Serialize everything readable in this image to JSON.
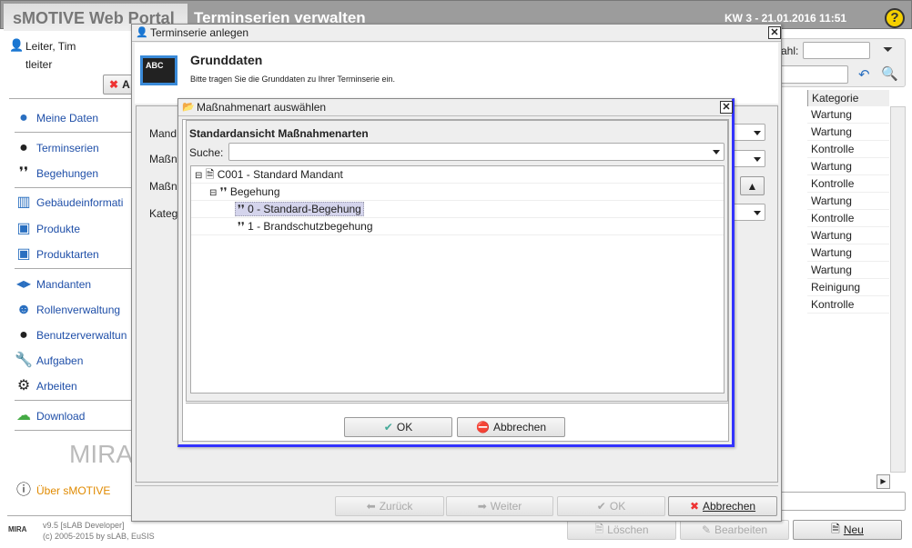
{
  "header": {
    "app_title": "sMOTIVE Web Portal",
    "page_title": "Terminserien verwalten",
    "datetime": "KW 3 - 21.01.2016 11:51",
    "help_icon": "help-icon"
  },
  "user": {
    "name": "Leiter, Tim",
    "login": "tleiter",
    "logout_label": "A"
  },
  "sidebar": {
    "items": [
      {
        "label": "Meine Daten",
        "icon": "user-icon"
      },
      {
        "label": "Terminserien",
        "icon": "series-icon"
      },
      {
        "label": "Begehungen",
        "icon": "footprints-icon"
      },
      {
        "label": "Gebäudeinformati",
        "icon": "building-icon"
      },
      {
        "label": "Produkte",
        "icon": "product-icon"
      },
      {
        "label": "Produktarten",
        "icon": "product-types-icon"
      },
      {
        "label": "Mandanten",
        "icon": "clients-icon"
      },
      {
        "label": "Rollenverwaltung",
        "icon": "roles-icon"
      },
      {
        "label": "Benutzerverwaltun",
        "icon": "users-icon"
      },
      {
        "label": "Aufgaben",
        "icon": "wrench-icon"
      },
      {
        "label": "Arbeiten",
        "icon": "gear-icon"
      },
      {
        "label": "Download",
        "icon": "download-icon"
      }
    ],
    "logo_text": "MIRA",
    "about": "Über sMOTIVE",
    "version": "v9.5 [sLAB Developer]",
    "copyright": "(c) 2005-2015 by sLAB, EuSIS",
    "about_color": "#e08a00"
  },
  "main": {
    "filter_label": "ahl:",
    "column_header": "Kategorie",
    "rows": [
      "Wartung",
      "Wartung",
      "Kontrolle",
      "Wartung",
      "Kontrolle",
      "Wartung",
      "Kontrolle",
      "Wartung",
      "Wartung",
      "Wartung",
      "Reinigung",
      "Kontrolle"
    ],
    "buttons": {
      "delete": "Löschen",
      "edit": "Bearbeiten",
      "new": "Neu"
    }
  },
  "dialog1": {
    "title": "Terminserie anlegen",
    "heading": "Grunddaten",
    "subtitle": "Bitte tragen Sie die Grunddaten zu Ihrer Terminserie ein.",
    "labels": [
      "Mand",
      "Maßn",
      "Maßn",
      "Kateg"
    ],
    "buttons": {
      "back": "Zurück",
      "next": "Weiter",
      "ok": "OK",
      "cancel": "Abbrechen"
    }
  },
  "dialog2": {
    "title": "Maßnahmenart auswählen",
    "heading": "Standardansicht Maßnahmenarten",
    "search_label": "Suche:",
    "search_value": "",
    "tree": {
      "root": "C001 - Standard Mandant",
      "group": "Begehung",
      "children": [
        "0 - Standard-Begehung",
        "1 - Brandschutzbegehung"
      ],
      "selected": "0 - Standard-Begehung"
    },
    "buttons": {
      "ok": "OK",
      "cancel": "Abbrechen"
    }
  }
}
